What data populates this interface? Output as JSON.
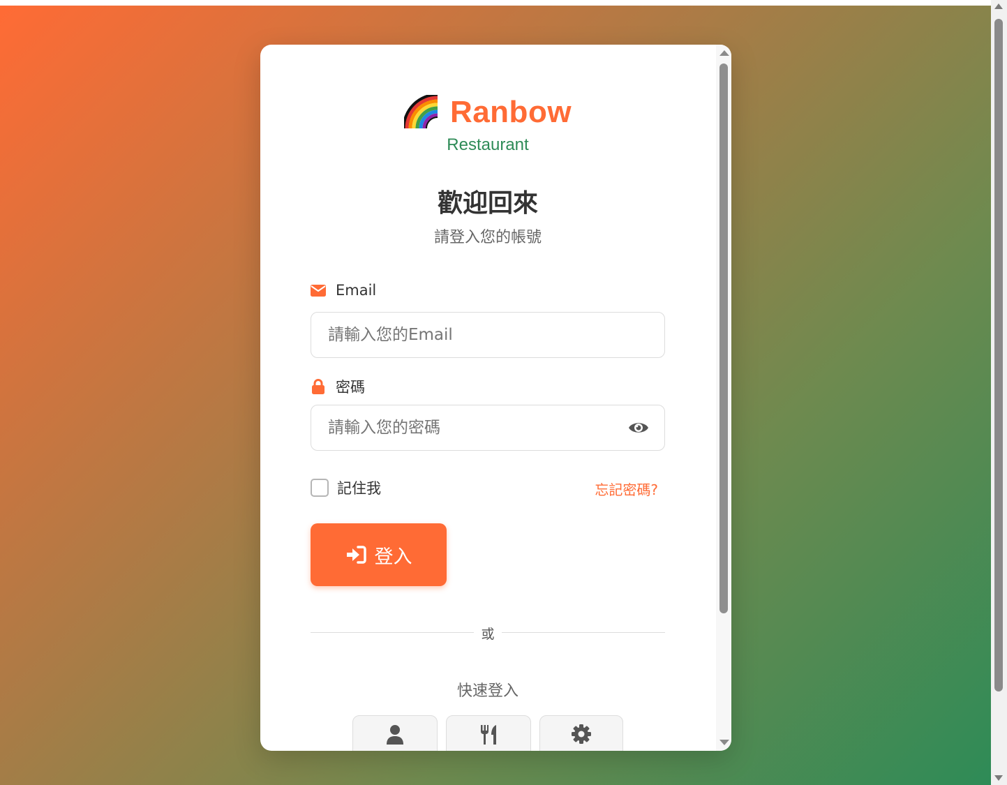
{
  "brand": {
    "icon": "rainbow-emoji",
    "name": "Ranbow",
    "subtitle": "Restaurant"
  },
  "welcome": {
    "title": "歡迎回來",
    "subtitle": "請登入您的帳號"
  },
  "form": {
    "email": {
      "icon": "envelope-icon",
      "label": "Email",
      "placeholder": "請輸入您的Email",
      "value": ""
    },
    "password": {
      "icon": "lock-icon",
      "label": "密碼",
      "placeholder": "請輸入您的密碼",
      "value": "",
      "toggle_icon": "eye-icon"
    },
    "remember_label": "記住我",
    "remember_checked": false,
    "forgot_link": "忘記密碼?",
    "login_button": "登入",
    "login_icon": "sign-in-icon"
  },
  "divider_text": "或",
  "quick_login": {
    "title": "快速登入",
    "buttons": [
      {
        "icon": "user-icon"
      },
      {
        "icon": "utensils-icon"
      },
      {
        "icon": "gear-icon"
      }
    ]
  },
  "colors": {
    "primary": "#ff6b35",
    "secondary": "#2e8b57",
    "text": "#333333",
    "muted": "#666666"
  }
}
